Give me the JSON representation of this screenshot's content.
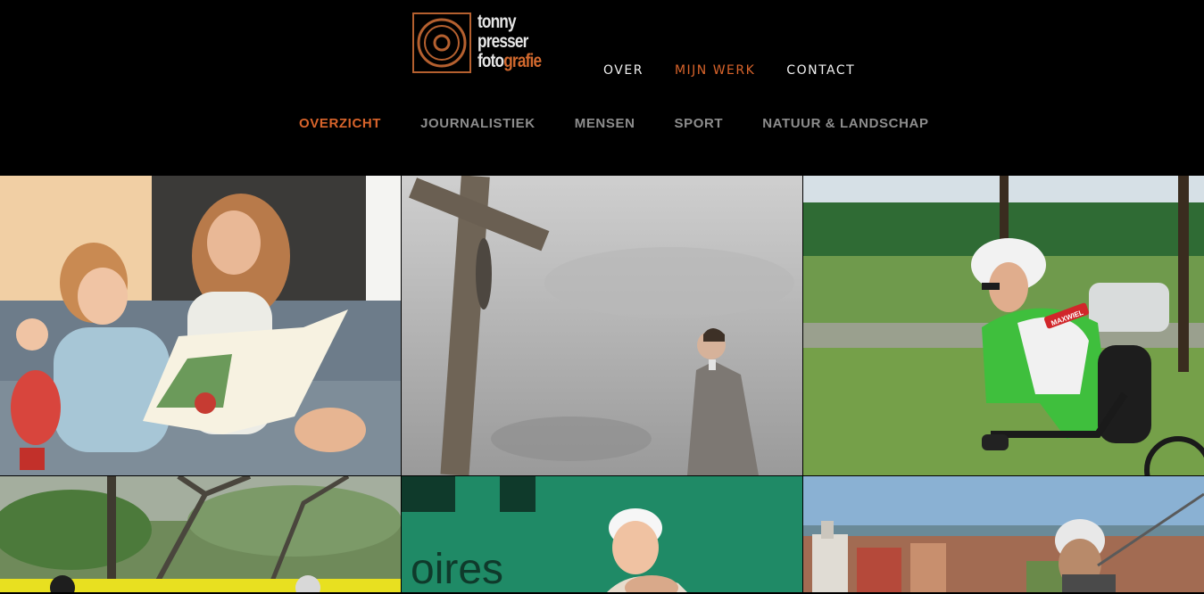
{
  "logo": {
    "line1": "tonny",
    "line2": "presser",
    "line3a": "foto",
    "line3b": "grafie"
  },
  "main_nav": [
    {
      "label": "OVER",
      "active": false
    },
    {
      "label": "MIJN WERK",
      "active": true
    },
    {
      "label": "CONTACT",
      "active": false
    }
  ],
  "sub_nav": [
    {
      "label": "OVERZICHT",
      "active": true
    },
    {
      "label": "JOURNALISTIEK",
      "active": false
    },
    {
      "label": "MENSEN",
      "active": false
    },
    {
      "label": "SPORT",
      "active": false
    },
    {
      "label": "NATUUR & LANDSCHAP",
      "active": false
    }
  ],
  "colors": {
    "accent": "#d9642b",
    "background": "#000000",
    "nav_inactive": "#8d8d8d"
  },
  "gallery": {
    "tile_3_text": "MAXWIEL"
  }
}
